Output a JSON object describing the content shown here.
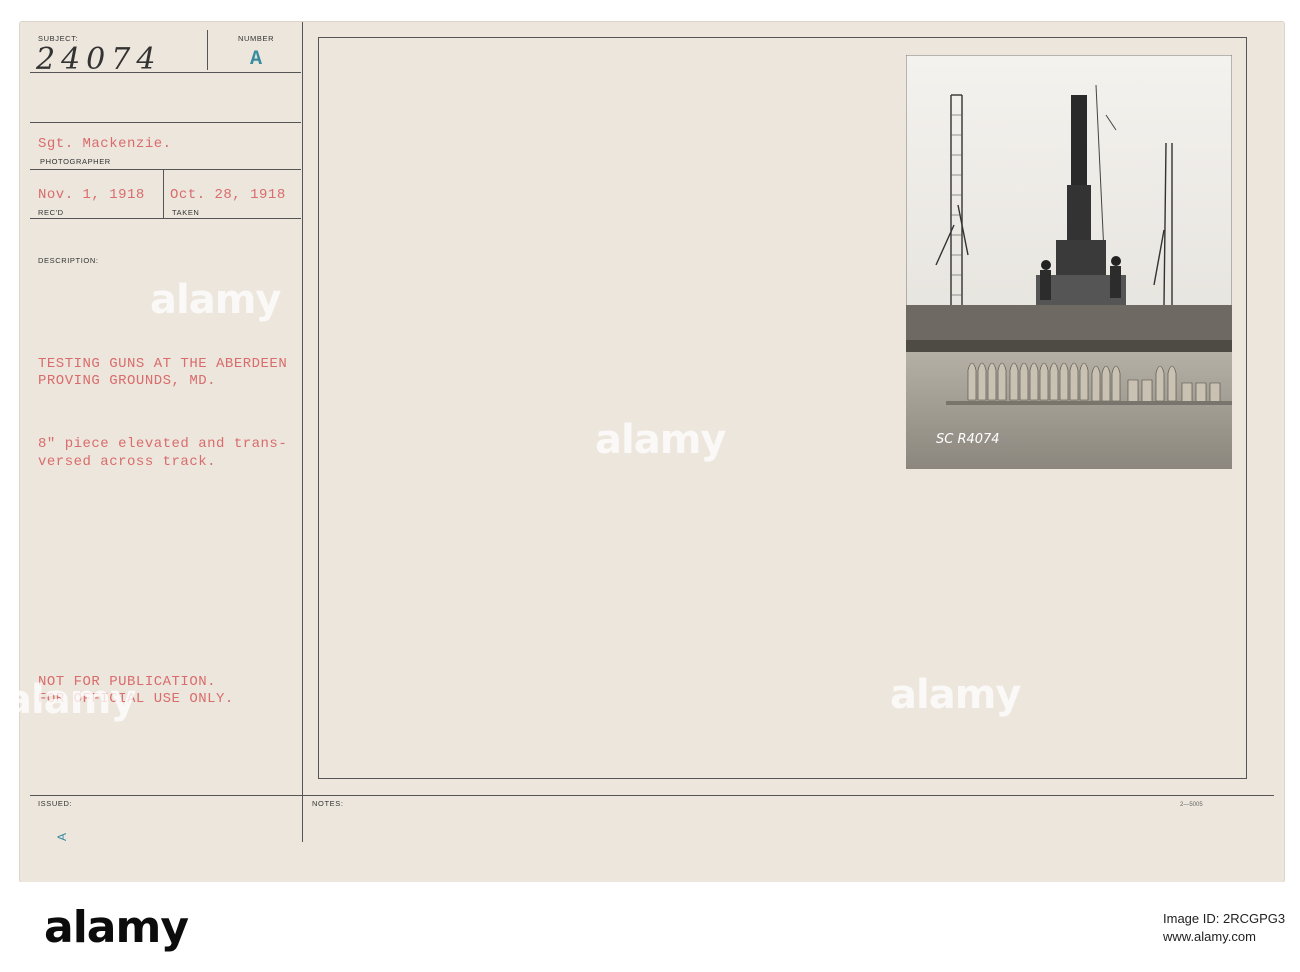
{
  "card": {
    "subject_label": "SUBJECT:",
    "subject_number": "24074",
    "number_label": "NUMBER",
    "number_value": "A",
    "photographer": "Sgt. Mackenzie.",
    "photographer_label": "PHOTOGRAPHER",
    "received_date": "Nov. 1, 1918",
    "received_label": "REC'D",
    "taken_date": "Oct. 28, 1918",
    "taken_label": "TAKEN",
    "description_label": "DESCRIPTION:",
    "description_title_1": "TESTING GUNS AT THE ABERDEEN",
    "description_title_2": "PROVING GROUNDS, MD.",
    "description_body_1": "8\" piece elevated and trans-",
    "description_body_2": "versed across track.",
    "restriction_1": "NOT FOR PUBLICATION.",
    "restriction_2": "FOR OFFICIAL USE ONLY.",
    "issued_label": "ISSUED:",
    "issued_mark": "A",
    "notes_label": "NOTES:",
    "form_number": "2—5005"
  },
  "photo": {
    "negative_marking": "SC R4074"
  },
  "watermark": {
    "text": "alamy"
  },
  "footer": {
    "logo": "alamy",
    "image_id_label": "Image ID: 2RCGPG3",
    "site": "www.alamy.com"
  },
  "colors": {
    "card": "#ece6dc",
    "typed_red": "#d96c6c",
    "stamp_teal": "#3a8aa0",
    "ink": "#222222"
  }
}
